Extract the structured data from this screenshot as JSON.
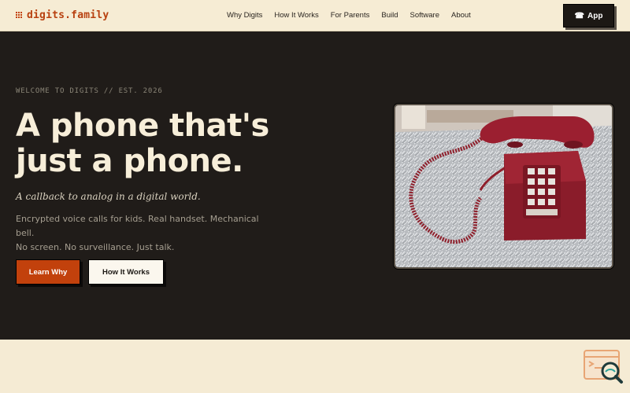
{
  "header": {
    "logo_text": "digits.family",
    "nav": [
      "Why Digits",
      "How It Works",
      "For Parents",
      "Build",
      "Software",
      "About"
    ],
    "app_button": {
      "icon": "telephone-icon",
      "glyph": "☎",
      "label": "App"
    }
  },
  "hero": {
    "eyebrow": "WELCOME TO DIGITS // EST. 2026",
    "headline_line1": "A phone that's",
    "headline_line2": "just a phone.",
    "tagline": "A callback to analog in a digital world.",
    "description_line1": "Encrypted voice calls for kids. Real handset. Mechanical bell.",
    "description_line2": "No screen. No surveillance. Just talk.",
    "primary_button": "Learn Why",
    "secondary_button": "How It Works",
    "image": "red-rotary-telephone-photo"
  },
  "colors": {
    "accent": "#c2410c",
    "hero_bg": "#201c19",
    "page_bg": "#f5ecd6",
    "headline": "#f7eed9"
  }
}
